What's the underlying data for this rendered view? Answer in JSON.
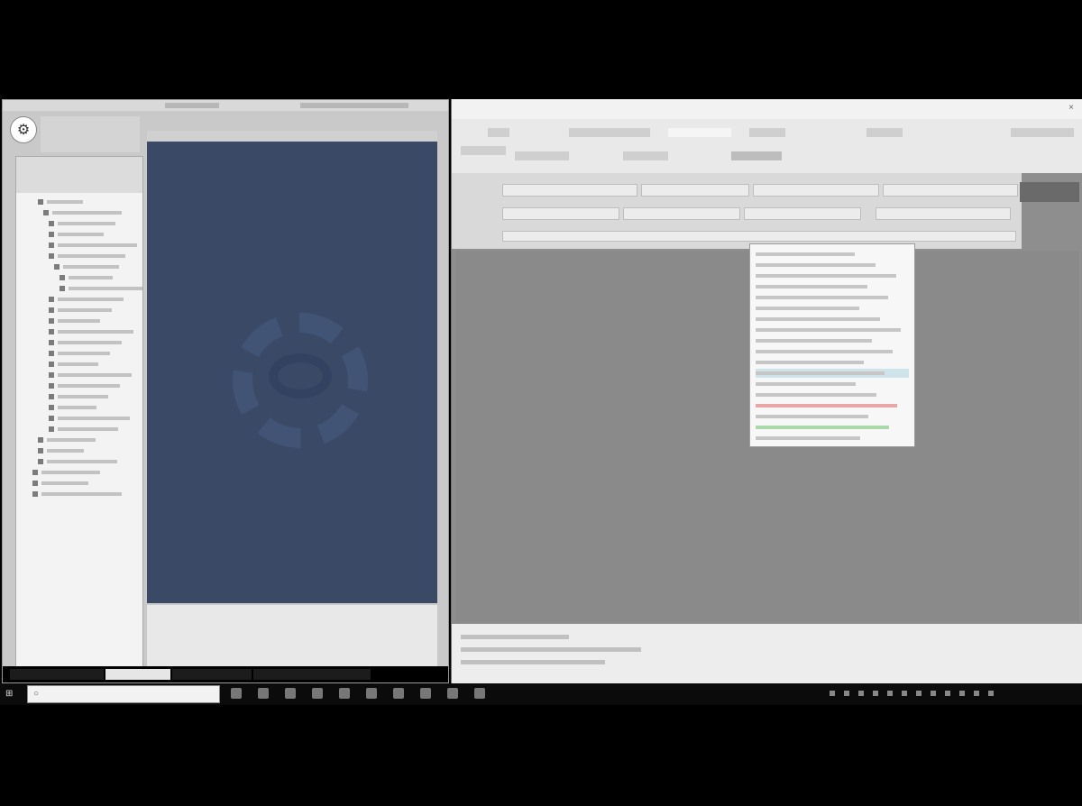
{
  "left_window": {
    "app_icon": "gear-logo-icon",
    "tree_rows": 28,
    "tabs": [
      "",
      "",
      "",
      ""
    ]
  },
  "right_window": {
    "title": "",
    "close_label": "×",
    "dropdown_items": 18,
    "selected_index": 11
  },
  "taskbar": {
    "start_icon": "windows-start-icon",
    "search_placeholder": "",
    "clock_time": "",
    "pinned_icon_count": 10
  },
  "colors": {
    "preview_bg": "#3a4a66",
    "workspace_bg": "#8a8a8a",
    "taskbar_bg": "#0b0b0b",
    "highlight": "#cfe3ea"
  }
}
